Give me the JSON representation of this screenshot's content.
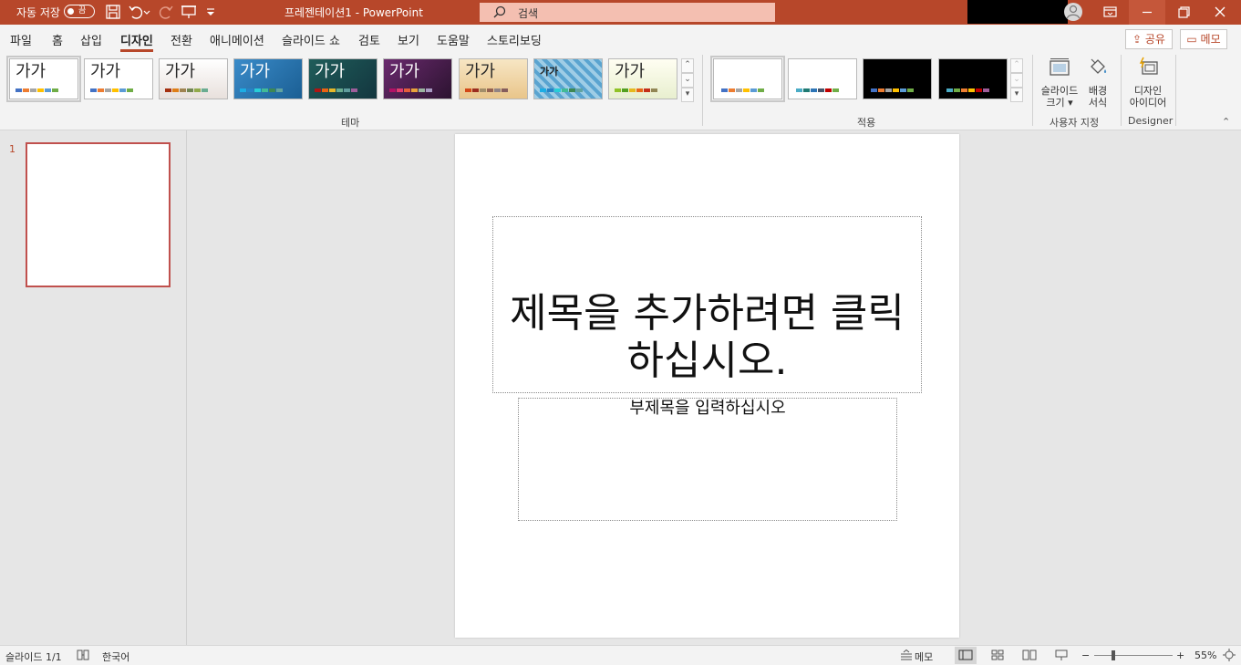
{
  "titlebar": {
    "autosave_label": "자동 저장",
    "autosave_state": "끔",
    "doc_title": "프레젠테이션1  -  PowerPoint",
    "search_placeholder": "검색"
  },
  "tabs": [
    {
      "label": "파일"
    },
    {
      "label": "홈"
    },
    {
      "label": "삽입"
    },
    {
      "label": "디자인"
    },
    {
      "label": "전환"
    },
    {
      "label": "애니메이션"
    },
    {
      "label": "슬라이드 쇼"
    },
    {
      "label": "검토"
    },
    {
      "label": "보기"
    },
    {
      "label": "도움말"
    },
    {
      "label": "스토리보딩"
    }
  ],
  "share_label": "공유",
  "memo_button_label": "메모",
  "ribbon": {
    "themes": {
      "group_label": "테마",
      "thumb_text": "가가"
    },
    "variants": {
      "group_label": "적용"
    },
    "customize": {
      "group_label": "사용자 지정",
      "slide_size_line1": "슬라이드",
      "slide_size_line2": "크기 ▾",
      "format_bg_line1": "배경",
      "format_bg_line2": "서식"
    },
    "designer": {
      "group_label": "Designer",
      "ideas_line1": "디자인",
      "ideas_line2": "아이디어"
    }
  },
  "slide_pane": {
    "slide_number": "1"
  },
  "slide": {
    "title_placeholder": "제목을 추가하려면 클릭하십시오.",
    "subtitle_placeholder": "부제목을 입력하십시오"
  },
  "statusbar": {
    "slide_info": "슬라이드 1/1",
    "language": "한국어",
    "notes_label": "메모",
    "zoom_minus": "−",
    "zoom_plus": "+",
    "zoom_level": "55%"
  },
  "colors": {
    "accent": "#b7472a",
    "search_bg": "#f4bfb1"
  }
}
